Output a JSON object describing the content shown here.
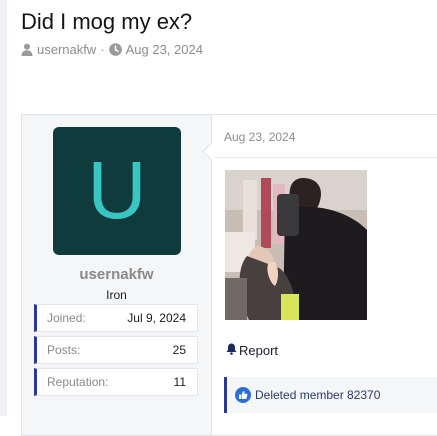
{
  "thread": {
    "title": "Did I mog my ex?",
    "author": "usernakfw",
    "separator": "·",
    "date": "Aug 23, 2024"
  },
  "post": {
    "user": {
      "avatar_letter": "U",
      "username": "usernakfw",
      "rank": "Iron",
      "stats": [
        {
          "label": "Joined:",
          "value": "Jul 9, 2024"
        },
        {
          "label": "Posts:",
          "value": "25"
        },
        {
          "label": "Reputation:",
          "value": "11"
        }
      ]
    },
    "date": "Aug 23, 2024",
    "report_label": "Report",
    "reaction_text": "Deleted member 82370"
  },
  "colors": {
    "avatar_bg": "#0f3b3c",
    "avatar_letter": "#39c6c2",
    "accent": "#2b3a8f",
    "like": "#2b6fd6"
  },
  "icons": [
    "user-icon",
    "clock-icon",
    "bell-icon",
    "like-icon"
  ]
}
